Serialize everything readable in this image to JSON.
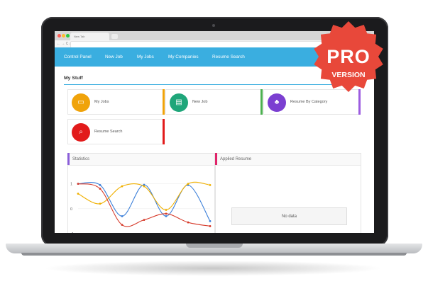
{
  "browser": {
    "tab_title": "New Tab",
    "address_nav": "← → C ⌂ ☆"
  },
  "nav": {
    "items": [
      "Control Panel",
      "New Job",
      "My Jobs",
      "My Companies",
      "Resume Search"
    ]
  },
  "page": {
    "title": "My Stuff"
  },
  "tiles": [
    {
      "label": "My Jobs",
      "icon": "briefcase-icon",
      "circle_color": "#f0a30a",
      "bar_color": "#f0a30a"
    },
    {
      "label": "New Job",
      "icon": "new-job-icon",
      "circle_color": "#1fa67a",
      "bar_color": "#4cb050"
    },
    {
      "label": "Resume By Category",
      "icon": "category-tree-icon",
      "circle_color": "#7b3fd1",
      "bar_color": "#9c5ce0"
    },
    {
      "label": "Resume Search",
      "icon": "search-document-icon",
      "circle_color": "#e21b1b",
      "bar_color": "#e21b1b"
    }
  ],
  "panels": {
    "statistics": {
      "title": "Statistics",
      "accent": "#8b5ed9"
    },
    "applied_resume": {
      "title": "Applied Resume",
      "accent": "#e0246a",
      "empty_text": "No data"
    }
  },
  "chart_data": {
    "type": "line",
    "x": [
      0,
      1,
      2,
      3,
      4,
      5,
      6
    ],
    "ylim": [
      -1,
      1.5
    ],
    "yticks": [
      "1",
      "0",
      "-1"
    ],
    "series": [
      {
        "color": "#3b7fd9",
        "values": [
          1.0,
          0.95,
          -0.3,
          0.96,
          -0.3,
          0.95,
          -0.5
        ]
      },
      {
        "color": "#f0b000",
        "values": [
          0.6,
          0.2,
          0.9,
          0.9,
          -0.05,
          1.0,
          0.95
        ]
      },
      {
        "color": "#d63a2a",
        "values": [
          1.0,
          0.8,
          -0.65,
          -0.45,
          -0.2,
          -0.55,
          -0.7
        ]
      }
    ]
  },
  "badge": {
    "line1": "PRO",
    "line2": "VERSION",
    "color": "#e8483a"
  }
}
